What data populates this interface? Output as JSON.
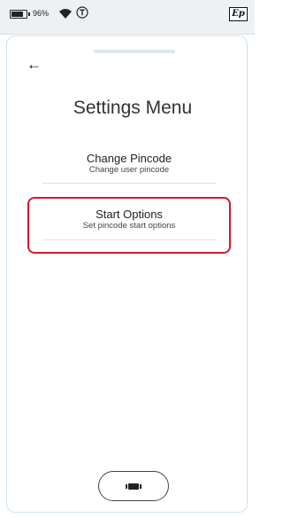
{
  "status_bar": {
    "battery_percent": "96%",
    "battery_level": 0.96,
    "brand_logo": "Ep",
    "icons": [
      "battery-icon",
      "wifi-icon",
      "circle-t-icon"
    ]
  },
  "nav": {
    "back_symbol": "←"
  },
  "page": {
    "title": "Settings Menu"
  },
  "menu": {
    "items": [
      {
        "title": "Change Pincode",
        "subtitle": "Change user pincode",
        "highlighted": false
      },
      {
        "title": "Start Options",
        "subtitle": "Set pincode start options",
        "highlighted": true
      }
    ]
  },
  "colors": {
    "highlight": "#d01a2c",
    "status_bar_bg": "#eef1f4",
    "panel_border": "#cfe3ee"
  }
}
